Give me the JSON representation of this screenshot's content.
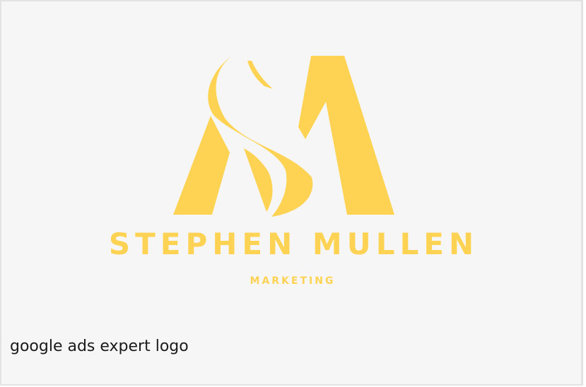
{
  "colors": {
    "card_background": "#f6f6f6",
    "card_border": "#e3e3e3",
    "logo_yellow": "#fed354",
    "caption_text": "#1a1a1a"
  },
  "logo": {
    "icon": "sm-monogram-logo-icon",
    "name": "STEPHEN MULLEN",
    "tagline": "MARKETING"
  },
  "caption": "google ads expert logo"
}
